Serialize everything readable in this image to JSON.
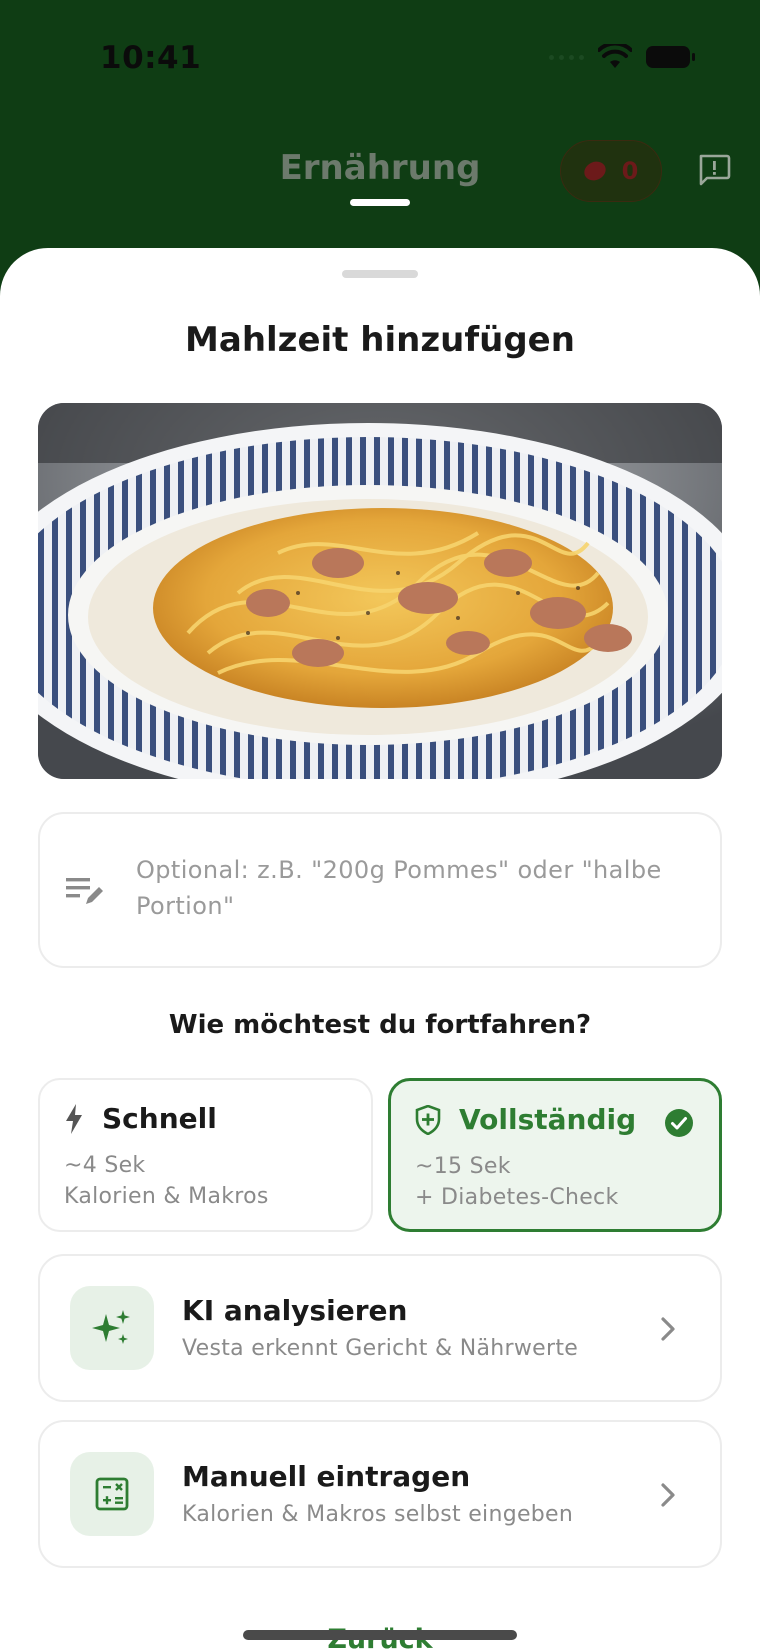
{
  "status_bar": {
    "time": "10:41"
  },
  "header": {
    "title": "Ernährung",
    "streak_count": "0"
  },
  "sheet": {
    "title": "Mahlzeit hinzufügen",
    "note_placeholder": "Optional: z.B. \"200g Pommes\" oder \"halbe Portion\"",
    "question": "Wie möchtest du fortfahren?",
    "modes": [
      {
        "title": "Schnell",
        "line1": "~4 Sek",
        "line2": "Kalorien & Makros",
        "selected": false
      },
      {
        "title": "Vollständig",
        "line1": "~15 Sek",
        "line2": "+ Diabetes-Check",
        "selected": true
      }
    ],
    "actions": [
      {
        "title": "KI analysieren",
        "subtitle": "Vesta erkennt Gericht & Nährwerte",
        "icon": "sparkles-icon"
      },
      {
        "title": "Manuell eintragen",
        "subtitle": "Kalorien & Makros selbst eingeben",
        "icon": "calculator-icon"
      }
    ],
    "back_label": "Zurück"
  },
  "colors": {
    "header_bg": "#0f3d14",
    "accent_green": "#2e7d32",
    "selected_bg": "#edf5ed"
  }
}
